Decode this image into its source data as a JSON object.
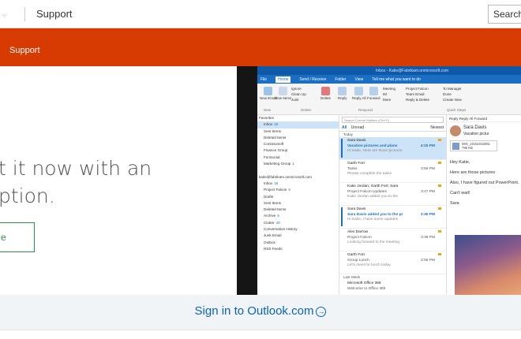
{
  "topbar": {
    "chevron_icon": "chevron-down-icon",
    "title": "Support",
    "search_label": "Search"
  },
  "subnav": {
    "label": "Support",
    "color": "#d83b01"
  },
  "hero": {
    "headline_line1": "t it now with an",
    "headline_line2": "ption.",
    "cta_label": "e"
  },
  "outlook": {
    "titlebar": "Inbox - Katie@Fabrikam.onmicrosoft.com",
    "menu": [
      "File",
      "Home",
      "Send / Receive",
      "Folder",
      "View",
      "Tell me what you want to do"
    ],
    "ribbon": {
      "new_email": "New Email",
      "new_items": "New Items",
      "ignore": "Ignore",
      "clean_up": "Clean Up",
      "junk": "Junk",
      "delete": "Delete",
      "reply": "Reply",
      "reply_all": "Reply All",
      "forward": "Forward",
      "meeting": "Meeting",
      "im": "IM",
      "more": "More",
      "project_falcon": "Project Falcon",
      "team_email": "Team Email",
      "reply_delete": "Reply & Delete",
      "to_manager": "To Manager",
      "done": "Done",
      "create_new": "Create New",
      "group_new": "New",
      "group_delete": "Delete",
      "group_respond": "Respond",
      "group_quick_steps": "Quick Steps"
    },
    "folders": [
      {
        "label": "Favorites",
        "count": "",
        "head": true
      },
      {
        "label": "Inbox",
        "count": "16",
        "selected": true
      },
      {
        "label": "Sent Items",
        "count": ""
      },
      {
        "label": "Deleted Items",
        "count": ""
      },
      {
        "label": "ContosoSoft",
        "count": ""
      },
      {
        "label": "Finance Group",
        "count": ""
      },
      {
        "label": "FunSocial",
        "count": ""
      },
      {
        "label": "Marketing Group",
        "count": "1"
      },
      {
        "label": "",
        "count": ""
      },
      {
        "label": "katie@fabrikam.onmicrosoft.com",
        "count": "",
        "head": true
      },
      {
        "label": "Inbox",
        "count": "16"
      },
      {
        "label": "Project Falcon",
        "count": "5"
      },
      {
        "label": "Drafts",
        "count": ""
      },
      {
        "label": "Sent Items",
        "count": ""
      },
      {
        "label": "Deleted Items",
        "count": ""
      },
      {
        "label": "Archive",
        "count": "5"
      },
      {
        "label": "Clutter",
        "count": "40"
      },
      {
        "label": "Conversation History",
        "count": ""
      },
      {
        "label": "Junk Email",
        "count": ""
      },
      {
        "label": "Outbox",
        "count": ""
      },
      {
        "label": "RSS Feeds",
        "count": ""
      }
    ],
    "search_placeholder": "Search Current Mailbox (Ctrl+E)",
    "mailbox_scope": "Current Mailbox",
    "filter_all": "All",
    "filter_unread": "Unread",
    "sort_label": "Newest",
    "group_today": "Today",
    "group_last_week": "Last Week",
    "messages": [
      {
        "from": "Sara Davis",
        "subject": "Vacation pictures and plans",
        "preview": "Hi Katie, Here are those pictures",
        "time": "4:15 PM",
        "unread": true,
        "selected": true
      },
      {
        "from": "Garth Fort",
        "subject": "Tasks",
        "preview": "Please complete the tasks",
        "time": "3:56 PM",
        "unread": false,
        "selected": false
      },
      {
        "from": "Katie Jordan; Garth Fort; Sara",
        "subject": "Project Falcon Updates",
        "preview": "Katie Jordan added you to the",
        "time": "3:47 PM",
        "unread": false,
        "selected": false
      },
      {
        "from": "Sara Davis",
        "subject": "Sara Davis added you to the pr",
        "preview": "Hi Katie, I have some updates",
        "time": "3:36 PM",
        "unread": true,
        "selected": false
      },
      {
        "from": "Alex Darrow",
        "subject": "Project Falcon",
        "preview": "Looking forward to the meeting",
        "time": "3:35 PM",
        "unread": false,
        "selected": false
      },
      {
        "from": "Garth Fort",
        "subject": "Group Lunch",
        "preview": "Let's meet for lunch today",
        "time": "2:56 PM",
        "unread": false,
        "selected": false
      },
      {
        "from": "Microsoft Office 365",
        "subject": "Welcome to Office 365",
        "preview": "",
        "time": "",
        "unread": false,
        "selected": false
      }
    ],
    "reading": {
      "actions": "Reply  Reply All  Forward",
      "sender": "Sara Davis",
      "subject": "Vacation pictur",
      "attachment_name": "IMG_10151015081",
      "attachment_size": "796 KB",
      "greeting": "Hey Katie,",
      "line1": "Here are those pictures",
      "line2": "Also, I have figured out PowerPoint.",
      "line3": "Can't wait!",
      "sign": "Sara"
    }
  },
  "footer": {
    "signin_label": "Sign in to Outlook.com",
    "arrow_icon": "arrow-right-circle-icon"
  }
}
